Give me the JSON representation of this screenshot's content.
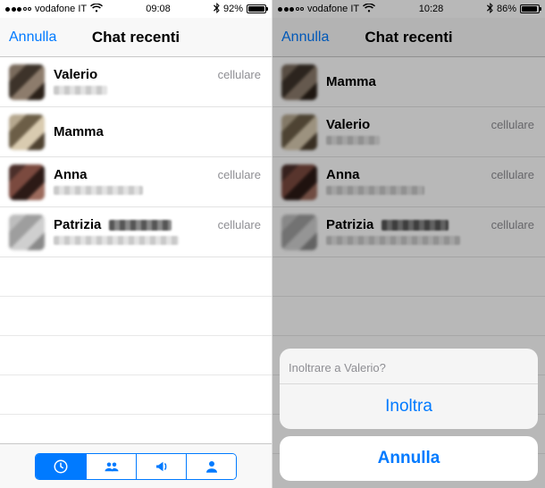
{
  "left": {
    "status": {
      "carrier": "vodafone IT",
      "time": "09:08",
      "battery_pct": "92%",
      "battery_fill": 92
    },
    "nav": {
      "cancel": "Annulla",
      "title": "Chat recenti"
    },
    "chats": [
      {
        "name": "Valerio",
        "surname_blurred": false,
        "sub_blurred": true,
        "type": "cellulare",
        "avatar": "a1"
      },
      {
        "name": "Mamma",
        "surname_blurred": false,
        "sub_blurred": false,
        "type": "",
        "avatar": "a2"
      },
      {
        "name": "Anna",
        "surname_blurred": false,
        "sub_blurred": true,
        "type": "cellulare",
        "avatar": "a3"
      },
      {
        "name": "Patrizia",
        "surname_blurred": true,
        "sub_blurred": true,
        "type": "cellulare",
        "avatar": "a4"
      }
    ],
    "tabs": {
      "active_index": 0,
      "icons": [
        "recents-icon",
        "groups-icon",
        "broadcast-icon",
        "contact-icon"
      ]
    }
  },
  "right": {
    "status": {
      "carrier": "vodafone IT",
      "time": "10:28",
      "battery_pct": "86%",
      "battery_fill": 86
    },
    "nav": {
      "cancel": "Annulla",
      "title": "Chat recenti"
    },
    "chats": [
      {
        "name": "Mamma",
        "surname_blurred": false,
        "sub_blurred": false,
        "type": "",
        "avatar": "a1"
      },
      {
        "name": "Valerio",
        "surname_blurred": false,
        "sub_blurred": true,
        "type": "cellulare",
        "avatar": "a2"
      },
      {
        "name": "Anna",
        "surname_blurred": false,
        "sub_blurred": true,
        "type": "cellulare",
        "avatar": "a3"
      },
      {
        "name": "Patrizia",
        "surname_blurred": true,
        "sub_blurred": true,
        "type": "cellulare",
        "avatar": "a4"
      }
    ],
    "sheet": {
      "title": "Inoltrare a Valerio?",
      "action": "Inoltra",
      "cancel": "Annulla"
    }
  }
}
